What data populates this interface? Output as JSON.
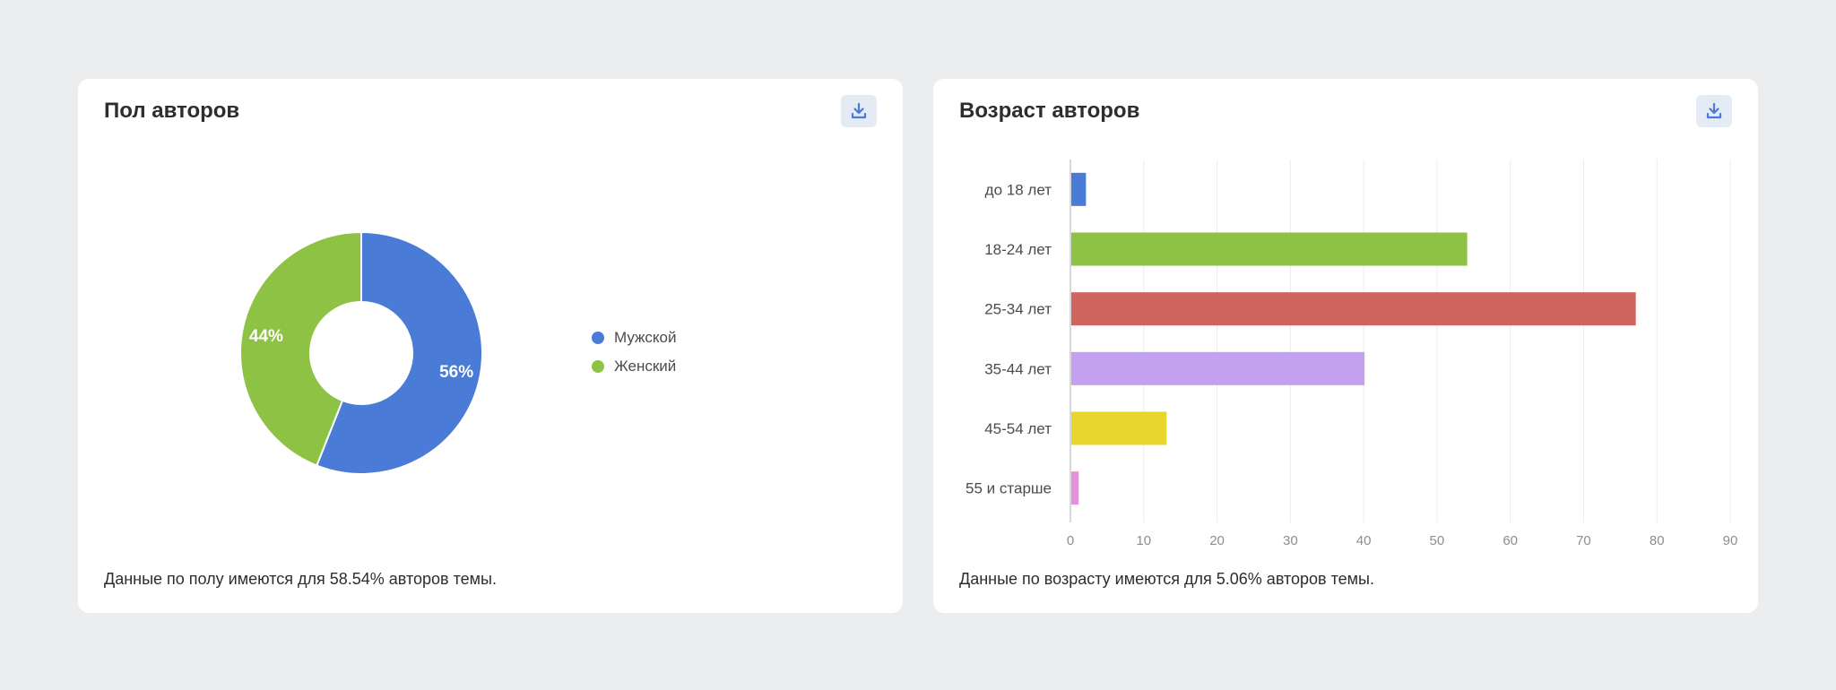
{
  "colors": {
    "male": "#4a7bd6",
    "female": "#8ec244",
    "accent": "#4a7bd6",
    "button_bg": "#e5ebf5"
  },
  "gender_card": {
    "title": "Пол авторов",
    "download_icon": "download-icon",
    "footer": "Данные по полу имеются для 58.54% авторов темы.",
    "legend": [
      {
        "label": "Мужской",
        "color": "#4a7bd6"
      },
      {
        "label": "Женский",
        "color": "#8ec244"
      }
    ]
  },
  "age_card": {
    "title": "Возраст авторов",
    "download_icon": "download-icon",
    "footer": "Данные по возрасту имеются для 5.06% авторов темы."
  },
  "chart_data": [
    {
      "type": "pie",
      "title": "Пол авторов",
      "categories": [
        "Мужской",
        "Женский"
      ],
      "values": [
        56,
        44
      ],
      "labels": [
        "56%",
        "44%"
      ],
      "colors": [
        "#4a7bd6",
        "#8ec244"
      ],
      "legend": "right"
    },
    {
      "type": "bar",
      "orientation": "horizontal",
      "title": "Возраст авторов",
      "categories": [
        "до 18 лет",
        "18-24 лет",
        "25-34 лет",
        "35-44 лет",
        "45-54 лет",
        "55 и старше"
      ],
      "values": [
        2,
        54,
        77,
        40,
        13,
        1
      ],
      "colors": [
        "#4a7bd6",
        "#8ec244",
        "#d0655f",
        "#c4a1f0",
        "#e8d62c",
        "#e391d8"
      ],
      "xlim": [
        0,
        90
      ],
      "xticks": [
        0,
        10,
        20,
        30,
        40,
        50,
        60,
        70,
        80,
        90
      ],
      "grid": true
    }
  ]
}
